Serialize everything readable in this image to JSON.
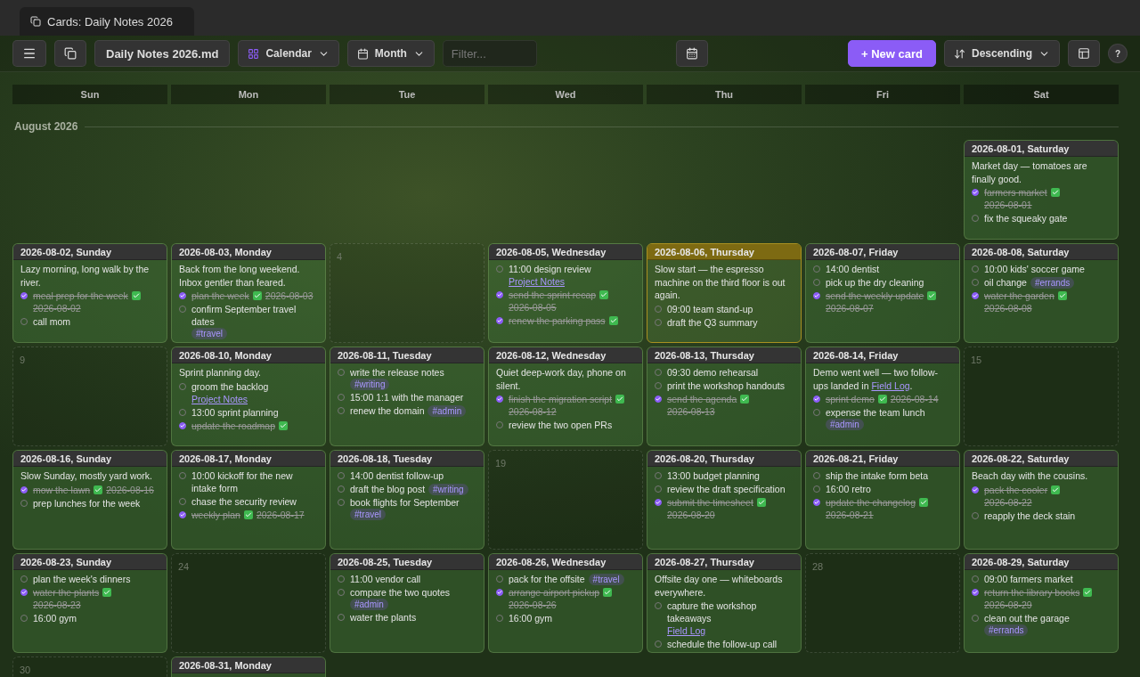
{
  "tab": {
    "title": "Cards: Daily Notes 2026"
  },
  "toolbar": {
    "file": "Daily Notes 2026.md",
    "view": "Calendar",
    "range": "Month",
    "filter_placeholder": "Filter...",
    "new_button": "+ New card",
    "sort": "Descending",
    "help": "?"
  },
  "weekdays": [
    "Sun",
    "Mon",
    "Tue",
    "Wed",
    "Thu",
    "Fri",
    "Sat"
  ],
  "month": "August 2026",
  "weeks": [
    [
      {
        "kind": "blank"
      },
      {
        "kind": "blank"
      },
      {
        "kind": "blank"
      },
      {
        "kind": "blank"
      },
      {
        "kind": "blank"
      },
      {
        "kind": "blank"
      },
      {
        "kind": "note",
        "title": "2026-08-01, Saturday",
        "today": false,
        "items": [
          {
            "kind": "text",
            "text": "Market day — tomatoes are finally good."
          },
          {
            "kind": "task",
            "done": true,
            "text": "farmers market",
            "date": "2026-08-01"
          },
          {
            "kind": "task",
            "done": false,
            "text": "fix the squeaky gate"
          }
        ]
      }
    ],
    [
      {
        "kind": "note",
        "title": "2026-08-02, Sunday",
        "today": false,
        "items": [
          {
            "kind": "text",
            "text": "Lazy morning, long walk by the river."
          },
          {
            "kind": "task",
            "done": true,
            "text": "meal prep for the week",
            "date": "2026-08-02"
          },
          {
            "kind": "task",
            "done": false,
            "text": "call mom"
          }
        ]
      },
      {
        "kind": "note",
        "title": "2026-08-03, Monday",
        "today": false,
        "items": [
          {
            "kind": "text",
            "text": "Back from the long weekend. Inbox gentler than feared."
          },
          {
            "kind": "task",
            "done": true,
            "text": "plan the week",
            "date": "2026-08-03"
          },
          {
            "kind": "task",
            "done": false,
            "text": "confirm September travel dates",
            "tag": "#travel"
          }
        ]
      },
      {
        "kind": "empty",
        "day": "4"
      },
      {
        "kind": "note",
        "title": "2026-08-05, Wednesday",
        "today": false,
        "items": [
          {
            "kind": "task",
            "done": false,
            "text": "11:00 design review",
            "link": "Project Notes"
          },
          {
            "kind": "task",
            "done": true,
            "text": "send the sprint recap",
            "date": "2026-08-05"
          },
          {
            "kind": "task",
            "done": true,
            "text": "renew the parking pass"
          }
        ]
      },
      {
        "kind": "note",
        "title": "2026-08-06, Thursday",
        "today": true,
        "items": [
          {
            "kind": "text",
            "text": "Slow start — the espresso machine on the third floor is out again."
          },
          {
            "kind": "task",
            "done": false,
            "text": "09:00 team stand-up"
          },
          {
            "kind": "task",
            "done": false,
            "text": "draft the Q3 summary"
          }
        ]
      },
      {
        "kind": "note",
        "title": "2026-08-07, Friday",
        "today": false,
        "items": [
          {
            "kind": "task",
            "done": false,
            "text": "14:00 dentist"
          },
          {
            "kind": "task",
            "done": false,
            "text": "pick up the dry cleaning"
          },
          {
            "kind": "task",
            "done": true,
            "text": "send the weekly update",
            "date": "2026-08-07"
          }
        ]
      },
      {
        "kind": "note",
        "title": "2026-08-08, Saturday",
        "today": false,
        "items": [
          {
            "kind": "task",
            "done": false,
            "text": "10:00 kids' soccer game"
          },
          {
            "kind": "task",
            "done": false,
            "text": "oil change",
            "tag": "#errands"
          },
          {
            "kind": "task",
            "done": true,
            "text": "water the garden",
            "date": "2026-08-08"
          }
        ]
      }
    ],
    [
      {
        "kind": "empty",
        "day": "9"
      },
      {
        "kind": "note",
        "title": "2026-08-10, Monday",
        "today": false,
        "items": [
          {
            "kind": "text",
            "text": "Sprint planning day."
          },
          {
            "kind": "task",
            "done": false,
            "text": "groom the backlog",
            "link": "Project Notes"
          },
          {
            "kind": "task",
            "done": false,
            "text": "13:00 sprint planning"
          },
          {
            "kind": "task",
            "done": true,
            "text": "update the roadmap"
          }
        ]
      },
      {
        "kind": "note",
        "title": "2026-08-11, Tuesday",
        "today": false,
        "items": [
          {
            "kind": "task",
            "done": false,
            "text": "write the release notes",
            "tag": "#writing"
          },
          {
            "kind": "task",
            "done": false,
            "text": "15:00 1:1 with the manager"
          },
          {
            "kind": "task",
            "done": false,
            "text": "renew the domain",
            "tag": "#admin"
          }
        ]
      },
      {
        "kind": "note",
        "title": "2026-08-12, Wednesday",
        "today": false,
        "items": [
          {
            "kind": "text",
            "text": "Quiet deep-work day, phone on silent."
          },
          {
            "kind": "task",
            "done": true,
            "text": "finish the migration script",
            "date": "2026-08-12"
          },
          {
            "kind": "task",
            "done": false,
            "text": "review the two open PRs"
          }
        ]
      },
      {
        "kind": "note",
        "title": "2026-08-13, Thursday",
        "today": false,
        "items": [
          {
            "kind": "task",
            "done": false,
            "text": "09:30 demo rehearsal"
          },
          {
            "kind": "task",
            "done": false,
            "text": "print the workshop handouts"
          },
          {
            "kind": "task",
            "done": true,
            "text": "send the agenda",
            "date": "2026-08-13"
          }
        ]
      },
      {
        "kind": "note",
        "title": "2026-08-14, Friday",
        "today": false,
        "items": [
          {
            "kind": "text",
            "text": "Demo went well — two follow-ups landed in",
            "link": "Field Log",
            "after": "."
          },
          {
            "kind": "task",
            "done": true,
            "text": "sprint demo",
            "date": "2026-08-14"
          },
          {
            "kind": "task",
            "done": false,
            "text": "expense the team lunch",
            "tag": "#admin"
          }
        ]
      },
      {
        "kind": "empty",
        "day": "15"
      }
    ],
    [
      {
        "kind": "note",
        "title": "2026-08-16, Sunday",
        "today": false,
        "items": [
          {
            "kind": "text",
            "text": "Slow Sunday, mostly yard work."
          },
          {
            "kind": "task",
            "done": true,
            "text": "mow the lawn",
            "date": "2026-08-16"
          },
          {
            "kind": "task",
            "done": false,
            "text": "prep lunches for the week"
          }
        ]
      },
      {
        "kind": "note",
        "title": "2026-08-17, Monday",
        "today": false,
        "items": [
          {
            "kind": "task",
            "done": false,
            "text": "10:00 kickoff for the new intake form"
          },
          {
            "kind": "task",
            "done": false,
            "text": "chase the security review"
          },
          {
            "kind": "task",
            "done": true,
            "text": "weekly plan",
            "date": "2026-08-17"
          }
        ]
      },
      {
        "kind": "note",
        "title": "2026-08-18, Tuesday",
        "today": false,
        "items": [
          {
            "kind": "task",
            "done": false,
            "text": "14:00 dentist follow-up"
          },
          {
            "kind": "task",
            "done": false,
            "text": "draft the blog post",
            "tag": "#writing"
          },
          {
            "kind": "task",
            "done": false,
            "text": "book flights for September",
            "tag": "#travel"
          }
        ]
      },
      {
        "kind": "empty",
        "day": "19"
      },
      {
        "kind": "note",
        "title": "2026-08-20, Thursday",
        "today": false,
        "items": [
          {
            "kind": "task",
            "done": false,
            "text": "13:00 budget planning"
          },
          {
            "kind": "task",
            "done": false,
            "text": "review the draft specification"
          },
          {
            "kind": "task",
            "done": true,
            "text": "submit the timesheet",
            "date": "2026-08-20"
          }
        ]
      },
      {
        "kind": "note",
        "title": "2026-08-21, Friday",
        "today": false,
        "items": [
          {
            "kind": "task",
            "done": false,
            "text": "ship the intake form beta"
          },
          {
            "kind": "task",
            "done": false,
            "text": "16:00 retro"
          },
          {
            "kind": "task",
            "done": true,
            "text": "update the changelog",
            "date": "2026-08-21"
          }
        ]
      },
      {
        "kind": "note",
        "title": "2026-08-22, Saturday",
        "today": false,
        "items": [
          {
            "kind": "text",
            "text": "Beach day with the cousins."
          },
          {
            "kind": "task",
            "done": true,
            "text": "pack the cooler",
            "date": "2026-08-22"
          },
          {
            "kind": "task",
            "done": false,
            "text": "reapply the deck stain"
          }
        ]
      }
    ],
    [
      {
        "kind": "note",
        "title": "2026-08-23, Sunday",
        "today": false,
        "items": [
          {
            "kind": "task",
            "done": false,
            "text": "plan the week's dinners"
          },
          {
            "kind": "task",
            "done": true,
            "text": "water the plants",
            "date": "2026-08-23"
          },
          {
            "kind": "task",
            "done": false,
            "text": "16:00 gym"
          }
        ]
      },
      {
        "kind": "empty",
        "day": "24"
      },
      {
        "kind": "note",
        "title": "2026-08-25, Tuesday",
        "today": false,
        "items": [
          {
            "kind": "task",
            "done": false,
            "text": "11:00 vendor call"
          },
          {
            "kind": "task",
            "done": false,
            "text": "compare the two quotes",
            "tag": "#admin"
          },
          {
            "kind": "task",
            "done": false,
            "text": "water the plants"
          }
        ]
      },
      {
        "kind": "note",
        "title": "2026-08-26, Wednesday",
        "today": false,
        "items": [
          {
            "kind": "task",
            "done": false,
            "text": "pack for the offsite",
            "tag": "#travel"
          },
          {
            "kind": "task",
            "done": true,
            "text": "arrange airport pickup",
            "date": "2026-08-26"
          },
          {
            "kind": "task",
            "done": false,
            "text": "16:00 gym"
          }
        ]
      },
      {
        "kind": "note",
        "title": "2026-08-27, Thursday",
        "today": false,
        "items": [
          {
            "kind": "text",
            "text": "Offsite day one — whiteboards everywhere."
          },
          {
            "kind": "task",
            "done": false,
            "text": "capture the workshop takeaways",
            "link": "Field Log"
          },
          {
            "kind": "task",
            "done": false,
            "text": "schedule the follow-up call"
          }
        ]
      },
      {
        "kind": "empty",
        "day": "28"
      },
      {
        "kind": "note",
        "title": "2026-08-29, Saturday",
        "today": false,
        "items": [
          {
            "kind": "task",
            "done": false,
            "text": "09:00 farmers market"
          },
          {
            "kind": "task",
            "done": true,
            "text": "return the library books",
            "date": "2026-08-29"
          },
          {
            "kind": "task",
            "done": false,
            "text": "clean out the garage",
            "tag": "#errands"
          }
        ]
      }
    ],
    [
      {
        "kind": "empty",
        "day": "30"
      },
      {
        "kind": "note",
        "title": "2026-08-31, Monday",
        "today": false
      }
    ]
  ]
}
